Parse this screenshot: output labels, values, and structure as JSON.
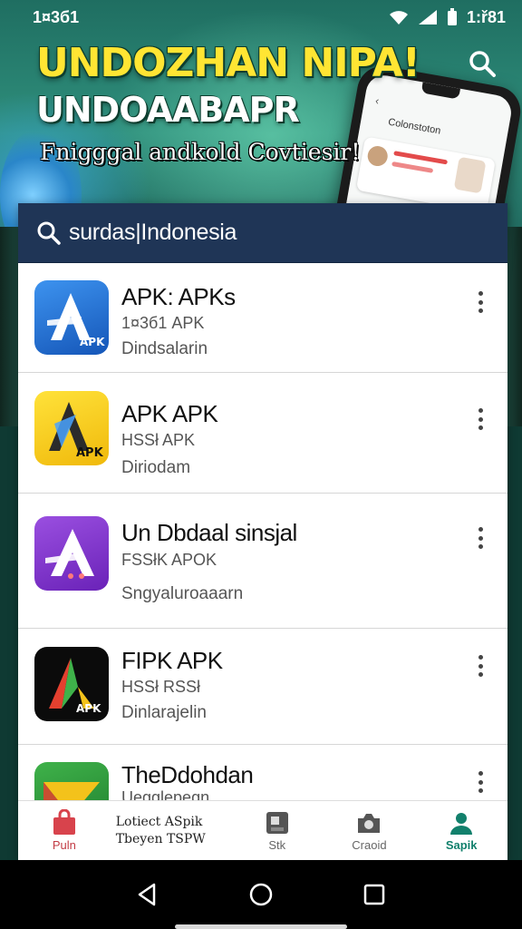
{
  "status_bar": {
    "time": "1¤3б1",
    "clock_right": "1:ř81"
  },
  "banner": {
    "headline_1": "UNDOZHAN NIPA!",
    "headline_2": "UNDOAABAPR",
    "headline_3": "Fnigggal andkold Covtiesir!",
    "phone_title": "Colonstoton"
  },
  "search": {
    "query": "surdas|Indonesia"
  },
  "apps": [
    {
      "title": "APK: APKs",
      "sub": "1¤3б1 APK",
      "desc": "Dindsalarin",
      "icon": "a-blue-icon",
      "color": "#1e6fd0"
    },
    {
      "title": "APK APK",
      "sub": "HSSł APK",
      "desc": "Diriodam",
      "icon": "a-yellow-icon",
      "color": "#f5d21a"
    },
    {
      "title": "Un Dbdaal sinsjal",
      "sub": "FSSłK APOK",
      "desc": "Sngyaluroaaarn",
      "icon": "a-purple-icon",
      "color": "#7a36c8"
    },
    {
      "title": "FIPK APK",
      "sub": "HSSł RSSł",
      "desc": "Dinlarajelin",
      "icon": "a-black-icon",
      "color": "#0b0b0b"
    },
    {
      "title": "TheDdohdan",
      "sub": "Uegglepegn",
      "desc": "",
      "icon": "a-green-icon",
      "color": "#2f9a3a"
    }
  ],
  "bottom_nav": {
    "items": [
      {
        "label": "Puln",
        "icon": "bag-icon"
      },
      {
        "label": "Stk",
        "icon": "store-icon"
      },
      {
        "label": "Craoid",
        "icon": "camera-icon"
      },
      {
        "label": "Sapik",
        "icon": "user-icon"
      }
    ],
    "promo_line1": "Lotiect ASpik",
    "promo_line2": "Tbeyen TSPW"
  },
  "colors": {
    "accent": "#12806c",
    "search_bg": "#1f3556",
    "headline_yellow": "#ffe533"
  }
}
